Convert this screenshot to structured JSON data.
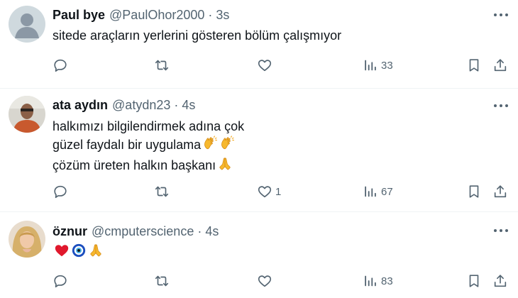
{
  "tweets": [
    {
      "name": "Paul bye",
      "handle": "@PaulOhor2000",
      "separator": "·",
      "time": "3s",
      "lines": [
        "sitede araçların yerlerini gösteren bölüm çalışmıyor"
      ],
      "likes": "",
      "views": "33",
      "avatar": "default-avatar"
    },
    {
      "name": "ata aydın",
      "handle": "@atydn23",
      "separator": "·",
      "time": "4s",
      "lines": [
        "halkımızı bilgilendirmek adına çok",
        "güzel faydalı bir uygulama",
        "çözüm üreten halkın başkanı"
      ],
      "likes": "1",
      "views": "67",
      "avatar": "photo-avatar"
    },
    {
      "name": "öznur",
      "handle": "@cmputerscience",
      "separator": "·",
      "time": "4s",
      "lines": [
        ""
      ],
      "likes": "",
      "views": "83",
      "avatar": "photo-avatar"
    }
  ],
  "icons": [
    "reply-icon",
    "retweet-icon",
    "like-icon",
    "views-icon",
    "bookmark-icon",
    "share-icon",
    "more-icon",
    "clapping-hands-emoji",
    "folded-hands-emoji",
    "red-heart-emoji",
    "nazar-amulet-emoji"
  ],
  "colors": {
    "text": "#0f1419",
    "secondary": "#536471",
    "divider": "#eff3f4"
  }
}
